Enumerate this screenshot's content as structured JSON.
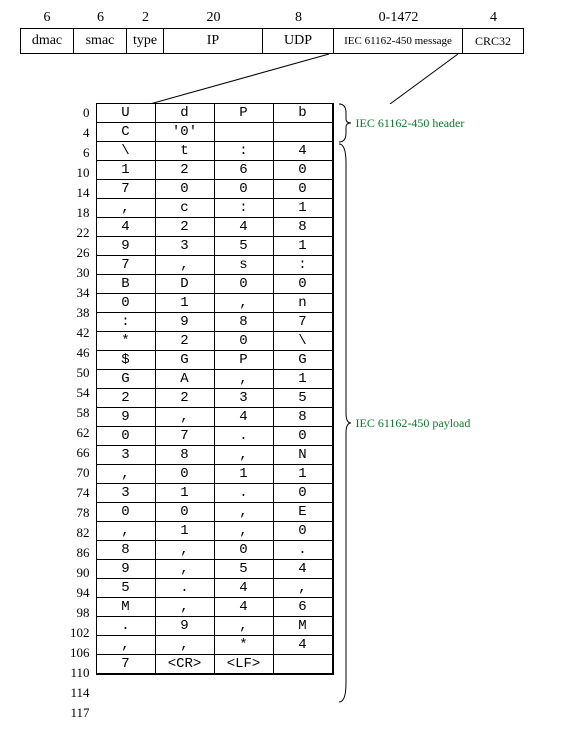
{
  "packet": {
    "fields": [
      {
        "size": "6",
        "label": "dmac",
        "wclass": "w-dmac"
      },
      {
        "size": "6",
        "label": "smac",
        "wclass": "w-smac"
      },
      {
        "size": "2",
        "label": "type",
        "wclass": "w-type"
      },
      {
        "size": "20",
        "label": "IP",
        "wclass": "w-ip"
      },
      {
        "size": "8",
        "label": "UDP",
        "wclass": "w-udp"
      },
      {
        "size": "0-1472",
        "label": "IEC 61162-450 message",
        "wclass": "w-msg"
      },
      {
        "size": "4",
        "label": "CRC32",
        "wclass": "w-crc"
      }
    ]
  },
  "payload": {
    "final_offset": "117",
    "rows": [
      {
        "offset": "0",
        "cells": [
          "U",
          "d",
          "P",
          "b"
        ]
      },
      {
        "offset": "4",
        "cells": [
          "C",
          "'0'",
          "",
          ""
        ]
      },
      {
        "offset": "6",
        "cells": [
          "\\",
          "t",
          ":",
          "4"
        ]
      },
      {
        "offset": "10",
        "cells": [
          "1",
          "2",
          "6",
          "0"
        ]
      },
      {
        "offset": "14",
        "cells": [
          "7",
          "0",
          "0",
          "0"
        ]
      },
      {
        "offset": "18",
        "cells": [
          ",",
          "c",
          ":",
          "1"
        ]
      },
      {
        "offset": "22",
        "cells": [
          "4",
          "2",
          "4",
          "8"
        ]
      },
      {
        "offset": "26",
        "cells": [
          "9",
          "3",
          "5",
          "1"
        ]
      },
      {
        "offset": "30",
        "cells": [
          "7",
          ",",
          "s",
          ":"
        ]
      },
      {
        "offset": "34",
        "cells": [
          "B",
          "D",
          "0",
          "0"
        ]
      },
      {
        "offset": "38",
        "cells": [
          "0",
          "1",
          ",",
          "n"
        ]
      },
      {
        "offset": "42",
        "cells": [
          ":",
          "9",
          "8",
          "7"
        ]
      },
      {
        "offset": "46",
        "cells": [
          "*",
          "2",
          "0",
          "\\"
        ]
      },
      {
        "offset": "50",
        "cells": [
          "$",
          "G",
          "P",
          "G"
        ]
      },
      {
        "offset": "54",
        "cells": [
          "G",
          "A",
          ",",
          "1"
        ]
      },
      {
        "offset": "58",
        "cells": [
          "2",
          "2",
          "3",
          "5"
        ]
      },
      {
        "offset": "62",
        "cells": [
          "9",
          ",",
          "4",
          "8"
        ]
      },
      {
        "offset": "66",
        "cells": [
          "0",
          "7",
          ".",
          "0"
        ]
      },
      {
        "offset": "70",
        "cells": [
          "3",
          "8",
          ",",
          "N"
        ]
      },
      {
        "offset": "74",
        "cells": [
          ",",
          "0",
          "1",
          "1"
        ]
      },
      {
        "offset": "78",
        "cells": [
          "3",
          "1",
          ".",
          "0"
        ]
      },
      {
        "offset": "82",
        "cells": [
          "0",
          "0",
          ",",
          "E"
        ]
      },
      {
        "offset": "86",
        "cells": [
          ",",
          "1",
          ",",
          "0"
        ]
      },
      {
        "offset": "90",
        "cells": [
          "8",
          ",",
          "0",
          "."
        ]
      },
      {
        "offset": "94",
        "cells": [
          "9",
          ",",
          "5",
          "4"
        ]
      },
      {
        "offset": "98",
        "cells": [
          "5",
          ".",
          "4",
          ","
        ]
      },
      {
        "offset": "102",
        "cells": [
          "M",
          ",",
          "4",
          "6"
        ]
      },
      {
        "offset": "106",
        "cells": [
          ".",
          "9",
          ",",
          "M"
        ]
      },
      {
        "offset": "110",
        "cells": [
          ",",
          ",",
          "*",
          "4"
        ]
      },
      {
        "offset": "114",
        "cells": [
          "7",
          "<CR>",
          "<LF>",
          ""
        ]
      }
    ],
    "brace_labels": {
      "header": "IEC 61162-450 header",
      "payload": "IEC 61162-450 payload"
    }
  }
}
